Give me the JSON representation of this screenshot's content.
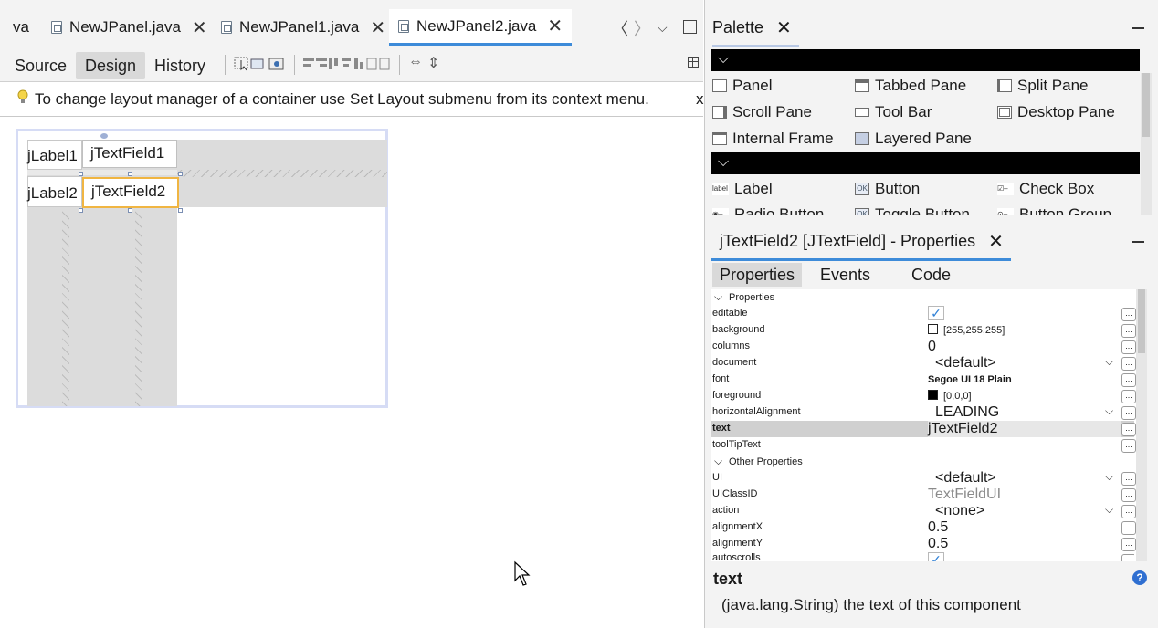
{
  "editor": {
    "tabs": [
      {
        "label": "va"
      },
      {
        "label": "NewJPanel.java"
      },
      {
        "label": "NewJPanel1.java"
      },
      {
        "label": "NewJPanel2.java",
        "active": true
      }
    ],
    "view_tabs": {
      "source": "Source",
      "design": "Design",
      "history": "History"
    },
    "hint": "To change layout manager of a container use Set Layout submenu from its context menu.",
    "hint_close": "x"
  },
  "form": {
    "label1": "jLabel1",
    "textfield1": "jTextField1",
    "label2": "jLabel2",
    "textfield2": "jTextField2"
  },
  "palette": {
    "title": "Palette",
    "containers": [
      "Panel",
      "Tabbed Pane",
      "Split Pane",
      "Scroll Pane",
      "Tool Bar",
      "Desktop Pane",
      "Internal Frame",
      "Layered Pane"
    ],
    "controls": [
      "Label",
      "Button",
      "Check Box",
      "Radio Button",
      "Toggle Button",
      "Button Group"
    ]
  },
  "properties": {
    "title": "jTextField2 [JTextField] - Properties",
    "tabs": {
      "properties": "Properties",
      "events": "Events",
      "code": "Code"
    },
    "section1": "Properties",
    "rows": [
      {
        "name": "editable",
        "value": "✓"
      },
      {
        "name": "background",
        "value": "[255,255,255]"
      },
      {
        "name": "columns",
        "value": "0"
      },
      {
        "name": "document",
        "value": "<default>"
      },
      {
        "name": "font",
        "value": "Segoe UI 18 Plain"
      },
      {
        "name": "foreground",
        "value": "[0,0,0]"
      },
      {
        "name": "horizontalAlignment",
        "value": "LEADING"
      },
      {
        "name": "text",
        "value": "jTextField2"
      },
      {
        "name": "toolTipText",
        "value": ""
      }
    ],
    "section2": "Other Properties",
    "other_rows": [
      {
        "name": "UI",
        "value": "<default>"
      },
      {
        "name": "UIClassID",
        "value": "TextFieldUI"
      },
      {
        "name": "action",
        "value": "<none>"
      },
      {
        "name": "alignmentX",
        "value": "0.5"
      },
      {
        "name": "alignmentY",
        "value": "0.5"
      },
      {
        "name": "autoscrolls",
        "value": "✓"
      }
    ],
    "ellipsis": "...",
    "help_title": "text",
    "help_text": "(java.lang.String) the text of this component"
  },
  "colors": {
    "accent": "#3d8bd9",
    "selection": "#f0b542",
    "background_swatch": "#ffffff",
    "foreground_swatch": "#000000"
  }
}
